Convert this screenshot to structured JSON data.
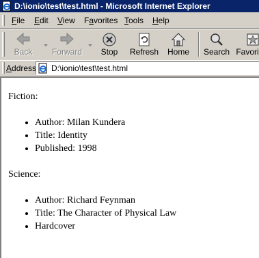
{
  "window": {
    "title": "D:\\ionio\\test\\test.html - Microsoft Internet Explorer"
  },
  "menu": {
    "items": [
      {
        "ul": "F",
        "rest": "ile"
      },
      {
        "ul": "E",
        "rest": "dit"
      },
      {
        "ul": "V",
        "rest": "iew"
      },
      {
        "pre": "F",
        "ul": "a",
        "rest": "vorites"
      },
      {
        "ul": "T",
        "rest": "ools"
      },
      {
        "ul": "H",
        "rest": "elp"
      }
    ]
  },
  "toolbar": {
    "back": "Back",
    "forward": "Forward",
    "stop": "Stop",
    "refresh": "Refresh",
    "home": "Home",
    "search": "Search",
    "favorites": "Favorites"
  },
  "address": {
    "label_ul": "A",
    "label_rest": "ddress",
    "url": "D:\\ionio\\test\\test.html"
  },
  "document": {
    "sections": [
      {
        "heading": "Fiction:",
        "items": [
          "Author: Milan Kundera",
          "Title: Identity",
          "Published: 1998"
        ]
      },
      {
        "heading": "Science:",
        "items": [
          "Author: Richard Feynman",
          "Title: The Character of Physical Law",
          "Hardcover"
        ]
      }
    ]
  }
}
